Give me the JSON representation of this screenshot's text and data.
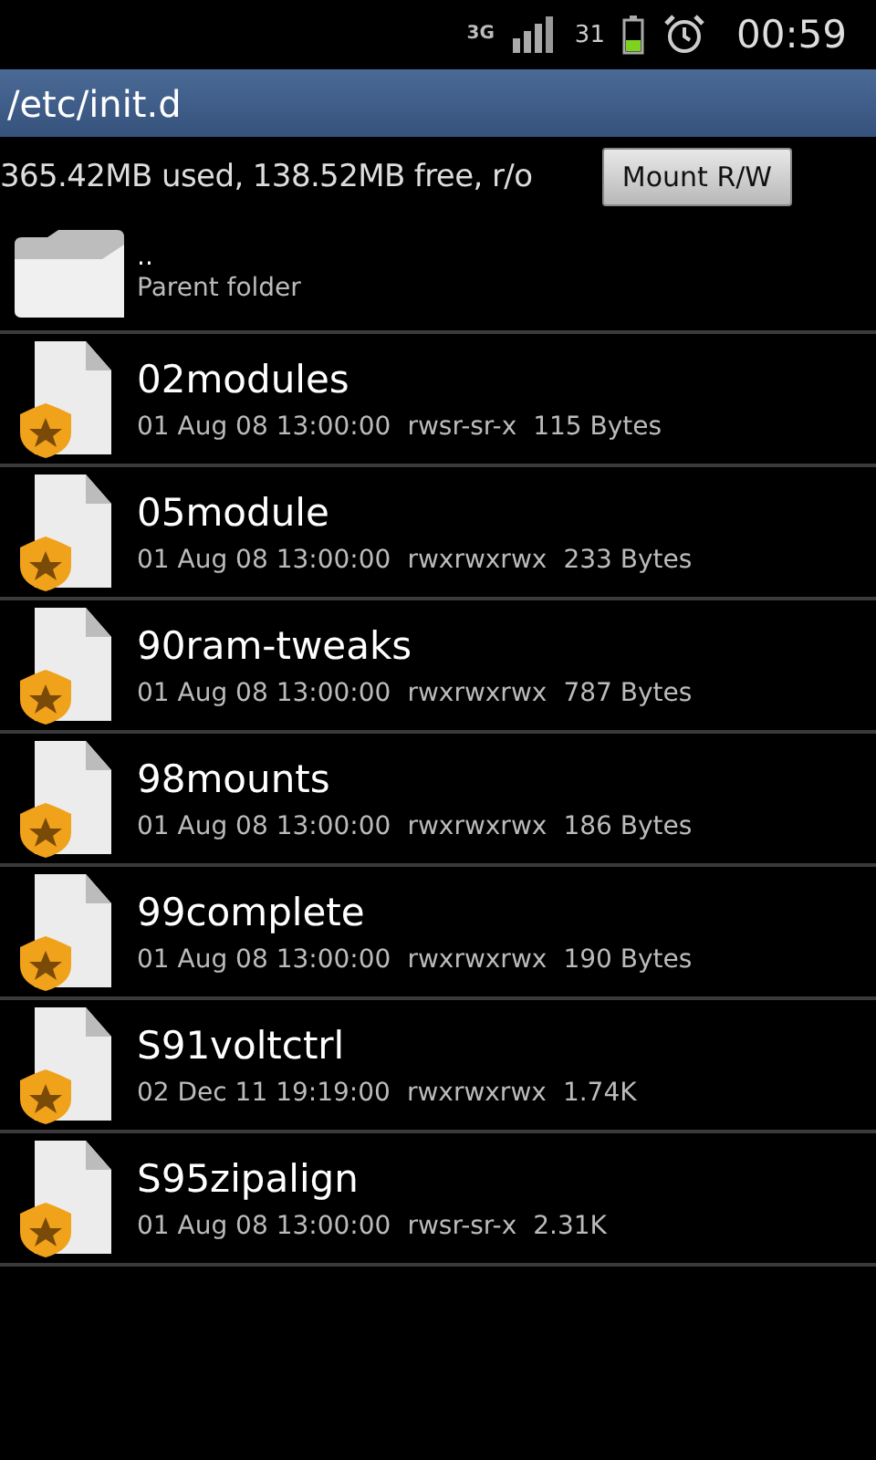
{
  "status_bar": {
    "network": "3G",
    "battery_text": "31",
    "time": "00:59"
  },
  "title": "/etc/init.d",
  "storage": {
    "text": "365.42MB used, 138.52MB free, r/o",
    "button": "Mount R/W"
  },
  "items": [
    {
      "kind": "parent",
      "name": "..",
      "subtitle": "Parent folder"
    },
    {
      "kind": "file",
      "name": "02modules",
      "date": "01 Aug 08 13:00:00",
      "permissions": "rwsr-sr-x",
      "size": "115 Bytes"
    },
    {
      "kind": "file",
      "name": "05module",
      "date": "01 Aug 08 13:00:00",
      "permissions": "rwxrwxrwx",
      "size": "233 Bytes"
    },
    {
      "kind": "file",
      "name": "90ram-tweaks",
      "date": "01 Aug 08 13:00:00",
      "permissions": "rwxrwxrwx",
      "size": "787 Bytes"
    },
    {
      "kind": "file",
      "name": "98mounts",
      "date": "01 Aug 08 13:00:00",
      "permissions": "rwxrwxrwx",
      "size": "186 Bytes"
    },
    {
      "kind": "file",
      "name": "99complete",
      "date": "01 Aug 08 13:00:00",
      "permissions": "rwxrwxrwx",
      "size": "190 Bytes"
    },
    {
      "kind": "file",
      "name": "S91voltctrl",
      "date": "02 Dec 11 19:19:00",
      "permissions": "rwxrwxrwx",
      "size": "1.74K"
    },
    {
      "kind": "file",
      "name": "S95zipalign",
      "date": "01 Aug 08 13:00:00",
      "permissions": "rwsr-sr-x",
      "size": "2.31K"
    }
  ]
}
